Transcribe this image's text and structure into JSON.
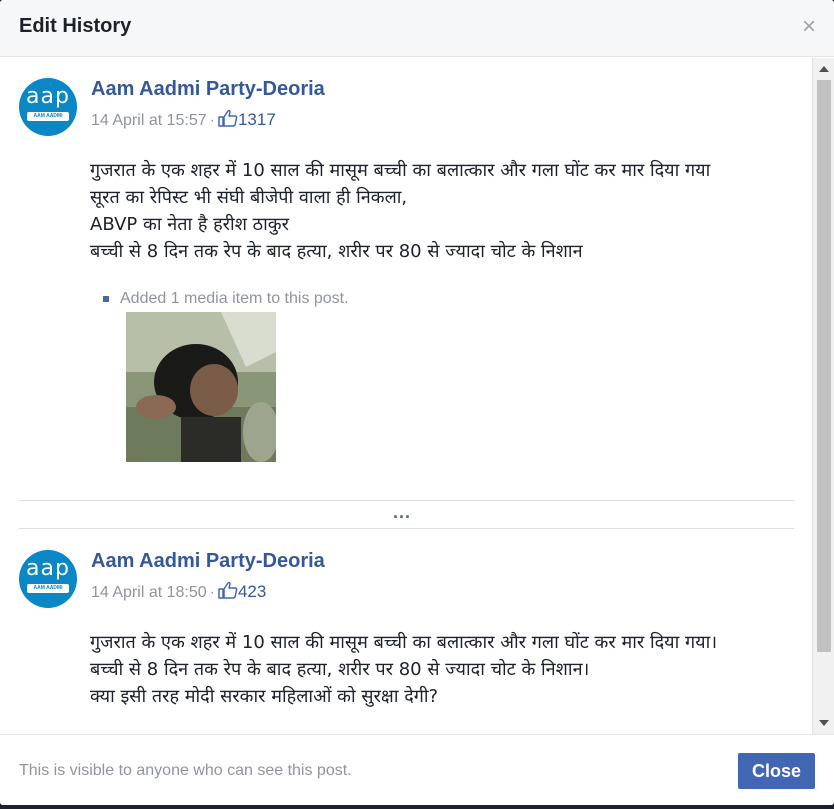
{
  "dialog": {
    "title": "Edit History",
    "close_icon": "×"
  },
  "entries": [
    {
      "avatar_text": "aap",
      "avatar_band": "AAM AADMI PARTY",
      "page_name": "Aam Aadmi Party-Deoria",
      "timestamp": "14 April at 15:57",
      "separator": "·",
      "likes": "1317",
      "text_lines": [
        "गुजरात के एक शहर में 10 साल की मासूम बच्ची का बलात्कार और गला घोंट कर मार दिया गया",
        "सूरत का रेपिस्ट भी संघी बीजेपी वाला ही निकला,",
        "ABVP का नेता है हरीश ठाकुर",
        "बच्ची से 8 दिन तक रेप के बाद हत्या, शरीर पर 80 से ज्यादा चोट के निशान"
      ],
      "change": "Added 1 media item to this post."
    },
    {
      "avatar_text": "aap",
      "avatar_band": "AAM AADMI PARTY",
      "page_name": "Aam Aadmi Party-Deoria",
      "timestamp": "14 April at 18:50",
      "separator": "·",
      "likes": "423",
      "text_lines": [
        "गुजरात के एक शहर में 10 साल की मासूम बच्ची का बलात्कार और गला घोंट कर मार दिया गया।",
        "बच्ची से 8 दिन तक रेप के बाद हत्या, शरीर पर 80 से ज्यादा चोट के निशान।",
        "क्या इसी तरह मोदी सरकार महिलाओं को सुरक्षा देगी?"
      ]
    }
  ],
  "ellipsis": "...",
  "footer": {
    "note": "This is visible to anyone who can see this post.",
    "close_label": "Close"
  },
  "colors": {
    "link": "#365899",
    "accent": "#4267b2",
    "muted": "#90949c",
    "avatar": "#0a87c4"
  },
  "icons": [
    "close-icon",
    "like-icon",
    "bullet-icon"
  ]
}
